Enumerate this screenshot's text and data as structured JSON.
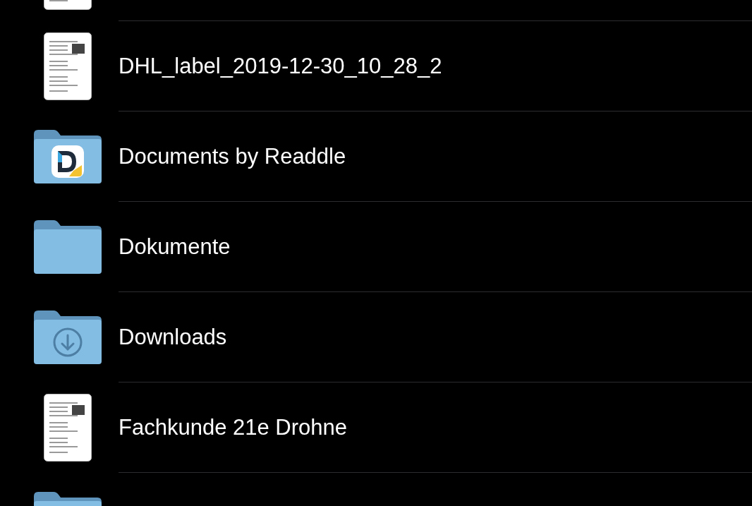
{
  "files": [
    {
      "kind": "document"
    },
    {
      "kind": "document",
      "name": "DHL_label_2019-12-30_10_28_2"
    },
    {
      "kind": "app-folder",
      "name": "Documents by Readdle"
    },
    {
      "kind": "folder",
      "name": "Dokumente"
    },
    {
      "kind": "download-folder",
      "name": "Downloads"
    },
    {
      "kind": "document",
      "name": "Fachkunde 21e Drohne"
    },
    {
      "kind": "folder"
    }
  ]
}
